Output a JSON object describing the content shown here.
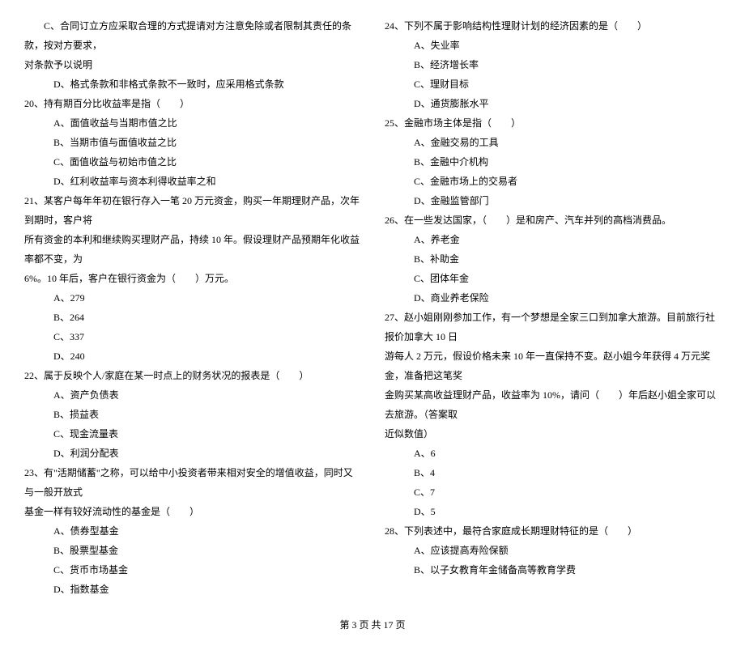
{
  "left": {
    "pre_lines": [
      "C、合同订立方应采取合理的方式提请对方注意免除或者限制其责任的条款，按对方要求，",
      "对条款予以说明",
      "D、格式条款和非格式条款不一致时，应采用格式条款"
    ],
    "q20": {
      "stem": "20、持有期百分比收益率是指（　　）",
      "opts": [
        "A、面值收益与当期市值之比",
        "B、当期市值与面值收益之比",
        "C、面值收益与初始市值之比",
        "D、红利收益率与资本利得收益率之和"
      ]
    },
    "q21": {
      "stem_lines": [
        "21、某客户每年年初在银行存入一笔 20 万元资金，购买一年期理财产品，次年到期时，客户将",
        "所有资金的本利和继续购买理财产品，持续 10 年。假设理财产品预期年化收益率都不变，为",
        "6%。10 年后，客户在银行资金为（　　）万元。"
      ],
      "opts": [
        "A、279",
        "B、264",
        "C、337",
        "D、240"
      ]
    },
    "q22": {
      "stem": "22、属于反映个人/家庭在某一时点上的财务状况的报表是（　　）",
      "opts": [
        "A、资产负债表",
        "B、损益表",
        "C、现金流量表",
        "D、利润分配表"
      ]
    },
    "q23": {
      "stem_lines": [
        "23、有\"活期储蓄\"之称，可以给中小投资者带来相对安全的增值收益，同时又与一般开放式",
        "基金一样有较好流动性的基金是（　　）"
      ],
      "opts": [
        "A、债券型基金",
        "B、股票型基金",
        "C、货币市场基金",
        "D、指数基金"
      ]
    }
  },
  "right": {
    "q24": {
      "stem": "24、下列不属于影响结构性理财计划的经济因素的是（　　）",
      "opts": [
        "A、失业率",
        "B、经济增长率",
        "C、理财目标",
        "D、通货膨胀水平"
      ]
    },
    "q25": {
      "stem": "25、金融市场主体是指（　　）",
      "opts": [
        "A、金融交易的工具",
        "B、金融中介机构",
        "C、金融市场上的交易者",
        "D、金融监管部门"
      ]
    },
    "q26": {
      "stem": "26、在一些发达国家，（　　）是和房产、汽车并列的高档消费品。",
      "opts": [
        "A、养老金",
        "B、补助金",
        "C、团体年金",
        "D、商业养老保险"
      ]
    },
    "q27": {
      "stem_lines": [
        "27、赵小姐刚刚参加工作，有一个梦想是全家三口到加拿大旅游。目前旅行社报价加拿大 10 日",
        "游每人 2 万元，假设价格未来 10 年一直保持不变。赵小姐今年获得 4 万元奖金，准备把这笔奖",
        "金购买某高收益理财产品，收益率为 10%，请问（　　）年后赵小姐全家可以去旅游。（答案取",
        "近似数值）"
      ],
      "opts": [
        "A、6",
        "B、4",
        "C、7",
        "D、5"
      ]
    },
    "q28": {
      "stem": "28、下列表述中，最符合家庭成长期理财特征的是（　　）",
      "opts": [
        "A、应该提高寿险保额",
        "B、以子女教育年金储备高等教育学费"
      ]
    }
  },
  "footer": "第 3 页 共 17 页"
}
